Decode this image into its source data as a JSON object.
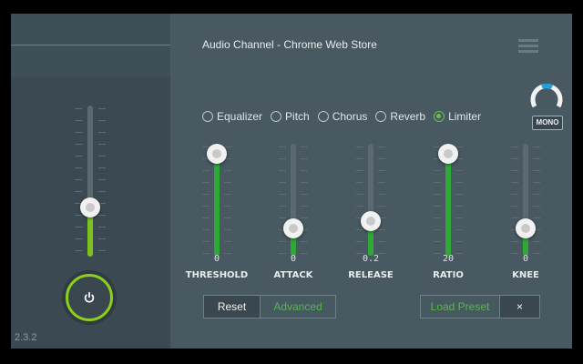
{
  "app": {
    "title": "Audio Channel - Chrome Web Store",
    "version": "2.3.2"
  },
  "sidebar": {
    "volume_level": 0.3,
    "power_on": true
  },
  "mono": {
    "label": "MONO"
  },
  "tabs": [
    {
      "label": "Equalizer",
      "selected": false
    },
    {
      "label": "Pitch",
      "selected": false
    },
    {
      "label": "Chorus",
      "selected": false
    },
    {
      "label": "Reverb",
      "selected": false
    },
    {
      "label": "Limiter",
      "selected": true
    }
  ],
  "sliders": [
    {
      "label": "THRESHOLD",
      "value": "0",
      "level": 1.0
    },
    {
      "label": "ATTACK",
      "value": "0",
      "level": 0.0
    },
    {
      "label": "RELEASE",
      "value": "0.2",
      "level": 0.1
    },
    {
      "label": "RATIO",
      "value": "20",
      "level": 1.0
    },
    {
      "label": "KNEE",
      "value": "0",
      "level": 0.0
    }
  ],
  "buttons": {
    "reset": "Reset",
    "advanced": "Advanced",
    "load_preset": "Load Preset",
    "clear": "×"
  },
  "colors": {
    "accent": "#7cc11c",
    "slider_fill": "#2fa935",
    "background": "#485962",
    "sidebar": "#3d4c54"
  },
  "icons": {
    "power": "power-icon",
    "menu": "hamburger-menu-icon",
    "clear": "close-icon"
  }
}
